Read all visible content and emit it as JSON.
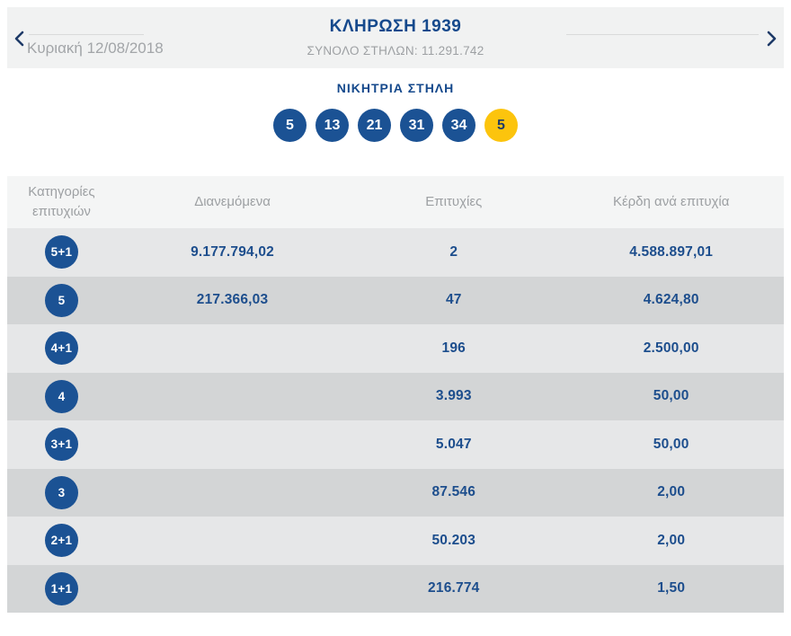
{
  "header": {
    "title": "ΚΛΗΡΩΣΗ 1939",
    "total_columns_label": "ΣΥΝΟΛΟ ΣΤΗΛΩΝ: 11.291.742",
    "date": "Κυριακή 12/08/2018",
    "prev_icon": "chevron-left",
    "next_icon": "chevron-right"
  },
  "winning": {
    "title": "ΝΙΚΗΤΡΙΑ ΣΤΗΛΗ",
    "numbers": [
      "5",
      "13",
      "21",
      "31",
      "34"
    ],
    "joker": "5"
  },
  "table": {
    "columns": [
      "Κατηγορίες επιτυχιών",
      "Διανεμόμενα",
      "Επιτυχίες",
      "Κέρδη ανά επιτυχία"
    ],
    "rows": [
      {
        "category": "5+1",
        "distributed": "9.177.794,02",
        "winners": "2",
        "prize": "4.588.897,01"
      },
      {
        "category": "5",
        "distributed": "217.366,03",
        "winners": "47",
        "prize": "4.624,80"
      },
      {
        "category": "4+1",
        "distributed": "",
        "winners": "196",
        "prize": "2.500,00"
      },
      {
        "category": "4",
        "distributed": "",
        "winners": "3.993",
        "prize": "50,00"
      },
      {
        "category": "3+1",
        "distributed": "",
        "winners": "5.047",
        "prize": "50,00"
      },
      {
        "category": "3",
        "distributed": "",
        "winners": "87.546",
        "prize": "2,00"
      },
      {
        "category": "2+1",
        "distributed": "",
        "winners": "50.203",
        "prize": "2,00"
      },
      {
        "category": "1+1",
        "distributed": "",
        "winners": "216.774",
        "prize": "1,50"
      }
    ]
  },
  "colors": {
    "primary_blue": "#1b5294",
    "value_text_blue": "#1d4e8d",
    "title_blue": "#15498c",
    "chevron_navy": "#1e3a68",
    "joker_yellow": "#fcc40d",
    "gray_text": "#9da0a3",
    "band_bg": "#f1f2f2",
    "table_header_bg": "#f4f5f5",
    "row_light_bg": "#e6e7e8",
    "row_dark_bg": "#d3d5d6"
  }
}
